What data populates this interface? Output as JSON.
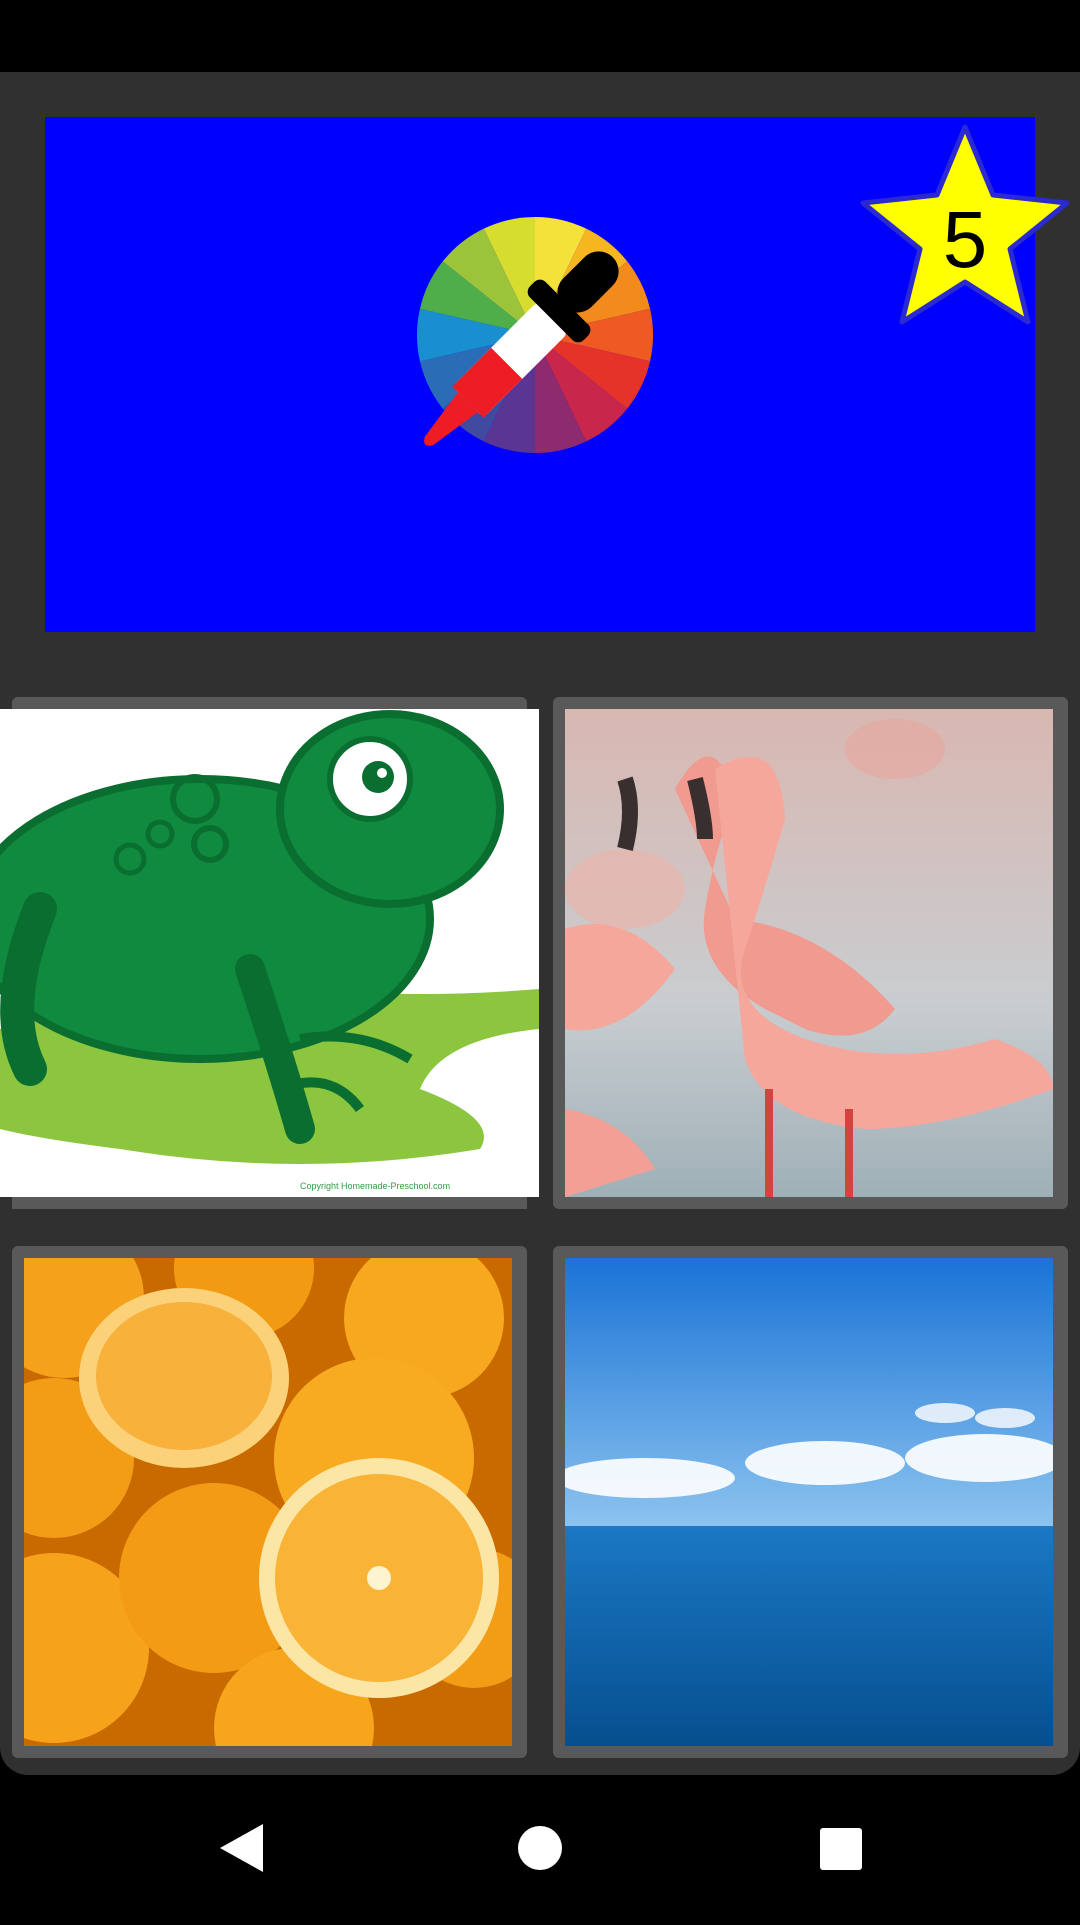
{
  "question": {
    "target_color": "#0000ff",
    "star_count": "5",
    "icon": "color-dropper-wheel-icon"
  },
  "answers": [
    {
      "name": "frog",
      "icon": "frog-image"
    },
    {
      "name": "flamingos",
      "icon": "flamingo-image"
    },
    {
      "name": "oranges",
      "icon": "orange-image"
    },
    {
      "name": "sea",
      "icon": "sea-sky-image"
    }
  ],
  "frog_copyright": "Copyright Homemade-Preschool.com",
  "navigation": {
    "back": "back-icon",
    "home": "home-icon",
    "recents": "recents-icon"
  },
  "colors": {
    "panel": "#303030",
    "tile_frame": "#595959",
    "star": "#ffff00"
  }
}
